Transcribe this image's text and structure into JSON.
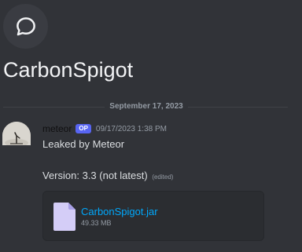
{
  "thread": {
    "icon": "chat-bubble-icon",
    "title": "CarbonSpigot"
  },
  "divider": {
    "date": "September 17, 2023"
  },
  "message": {
    "author": "meteor",
    "badge": "OP",
    "timestamp": "09/17/2023 1:38 PM",
    "line1": "Leaked by Meteor",
    "line2": "Version: 3.3 (not latest)",
    "edited": "(edited)"
  },
  "attachment": {
    "icon": "file-icon",
    "filename": "CarbonSpigot.jar",
    "size": "49.33 MB"
  },
  "colors": {
    "background": "#313338",
    "op_badge": "#5865f2",
    "link": "#00a8fc",
    "attachment_bg": "#2b2d31"
  }
}
